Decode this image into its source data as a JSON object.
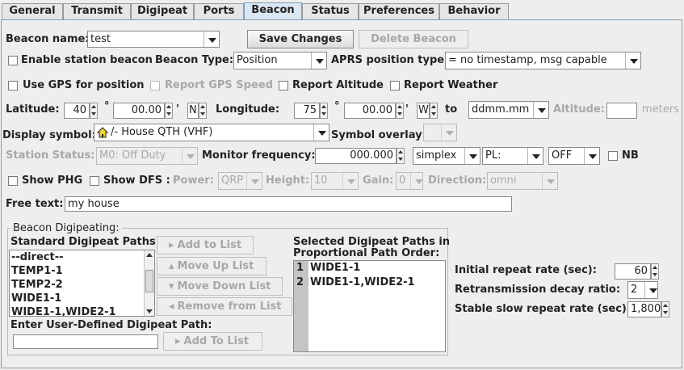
{
  "tabs": [
    "General",
    "Transmit",
    "Digipeat",
    "Ports",
    "Beacon",
    "Status",
    "Preferences",
    "Behavior"
  ],
  "beacon_name": {
    "label": "Beacon name:",
    "value": "test"
  },
  "save_button": "Save Changes",
  "delete_button": "Delete Beacon",
  "enable_beacon": "Enable station beacon",
  "beacon_type": {
    "label": "Beacon Type:",
    "value": "Position"
  },
  "aprs_type": {
    "label": "APRS position type:",
    "value": "= no timestamp, msg capable"
  },
  "gps": {
    "use": "Use GPS for position",
    "speed": "Report GPS Speed",
    "altitude": "Report Altitude",
    "weather": "Report Weather"
  },
  "lat": {
    "label": "Latitude:",
    "deg": "40",
    "min": "00.00",
    "sym": "°",
    "tick": "'",
    "hem": "N"
  },
  "lon": {
    "label": "Longitude:",
    "deg": "75",
    "min": "00.00",
    "sym": "°",
    "tick": "'",
    "hem": "W"
  },
  "to": "to",
  "format": "ddmm.mm",
  "altitude": {
    "label": "Altitude:",
    "unit": "meters"
  },
  "symbol": {
    "label": "Display symbol:",
    "value": "/-  House QTH (VHF)",
    "overlay": "Symbol overlay:"
  },
  "status": {
    "label": "Station Status:",
    "value": "M0: Off Duty"
  },
  "monitor": {
    "label": "Monitor frequency:",
    "value": "000.000",
    "mode": "simplex",
    "pl": "PL:",
    "off": "OFF",
    "nb": "NB"
  },
  "phg": {
    "show": "Show PHG",
    "dfs": "Show DFS :",
    "power_label": "Power:",
    "power": "QRP",
    "height_label": "Height:",
    "height": "10",
    "gain_label": "Gain:",
    "gain": "0",
    "dir_label": "Direction:",
    "dir": "omni"
  },
  "free_text": {
    "label": "Free text:",
    "value": "my house"
  },
  "digi": {
    "group_title": "Beacon Digipeating:",
    "std_label": "Standard Digipeat Paths:",
    "std_items": [
      "--direct--",
      "TEMP1-1",
      "TEMP2-2",
      "WIDE1-1",
      "WIDE1-1,WIDE2-1"
    ],
    "add": "Add to List",
    "up": "Move Up List",
    "down": "Move Down List",
    "remove": "Remove from List",
    "selected_label1": "Selected Digipeat Paths in",
    "selected_label2": "Proportional Path Order:",
    "selected": [
      {
        "n": "1",
        "path": "WIDE1-1"
      },
      {
        "n": "2",
        "path": "WIDE1-1,WIDE2-1"
      }
    ],
    "user_label": "Enter User-Defined Digipeat Path:",
    "add_to_list": "Add To List"
  },
  "repeat": {
    "initial_label": "Initial repeat rate (sec):",
    "initial": "60",
    "decay_label": "Retransmission decay ratio:",
    "decay": "2",
    "slow_label": "Stable slow repeat rate (sec):",
    "slow": "1,800"
  }
}
